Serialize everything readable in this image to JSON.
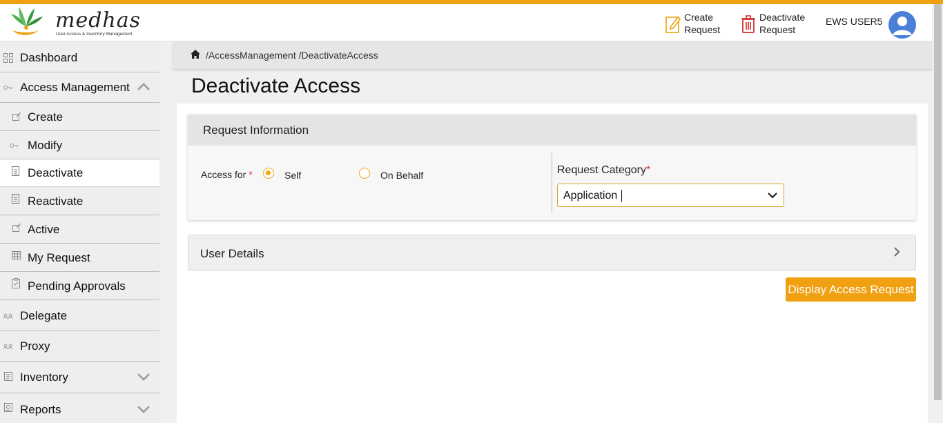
{
  "brand": {
    "name": "medhas",
    "tagline": "User Access & Inventory Management",
    "accent_color": "#f0a010"
  },
  "header": {
    "create_request_label": "Create Request",
    "deactivate_request_label": "Deactivate Request",
    "user_name": "EWS USER5"
  },
  "sidebar": {
    "items": [
      {
        "label": "Dashboard",
        "icon": "grid-icon"
      },
      {
        "label": "Access Management",
        "icon": "key-icon",
        "expanded": true
      },
      {
        "label": "Create",
        "icon": "edit-icon"
      },
      {
        "label": "Modify",
        "icon": "key-icon"
      },
      {
        "label": "Deactivate",
        "icon": "document-icon",
        "active": true
      },
      {
        "label": "Reactivate",
        "icon": "document-icon"
      },
      {
        "label": "Active",
        "icon": "edit-icon"
      },
      {
        "label": "My Request",
        "icon": "table-icon"
      },
      {
        "label": "Pending Approvals",
        "icon": "clipboard-icon"
      },
      {
        "label": "Delegate",
        "icon": "users-icon"
      },
      {
        "label": "Proxy",
        "icon": "users-icon"
      },
      {
        "label": "Inventory",
        "icon": "document-icon",
        "expanded": false
      },
      {
        "label": "Reports",
        "icon": "report-icon",
        "expanded": false
      }
    ]
  },
  "breadcrumb": "/AccessManagement /DeactivateAccess",
  "page": {
    "title": "Deactivate Access"
  },
  "request_info": {
    "title": "Request Information",
    "access_for_label": "Access for",
    "options": [
      "Self",
      "On Behalf"
    ],
    "selected_option": "Self",
    "category_label": "Request Category",
    "category_value": "Application"
  },
  "user_details": {
    "title": "User Details"
  },
  "actions": {
    "display_label": "Display Access Request"
  }
}
